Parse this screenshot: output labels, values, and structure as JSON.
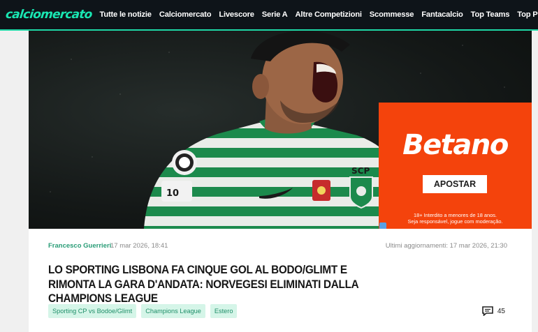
{
  "header": {
    "logo_text": "calciomercato",
    "brand_color": "#19e6b2",
    "nav": [
      "Tutte le notizie",
      "Calciomercato",
      "Livescore",
      "Serie A",
      "Altre Competizioni",
      "Scommesse",
      "Fantacalcio",
      "Top Teams",
      "Top Players"
    ]
  },
  "ad": {
    "brand": "Betano",
    "button_label": "APOSTAR",
    "disclaimer_line1": "18+ Interdito a menores de 18 anos.",
    "disclaimer_line2": "Seja responsável, jogue com moderação.",
    "background_color": "#f4430c"
  },
  "hero": {
    "jersey_text": "SCP",
    "jersey_number": "10"
  },
  "article": {
    "author": "Francesco Guerrieri",
    "date": "17 mar 2026, 18:41",
    "updated": "Ultimi aggiornamenti: 17 mar 2026, 21:30",
    "title": "Lo Sporting Lisbona fa cinque gol al Bodo/Glimt e rimonta la gara d'andata: norvegesi eliminati dalla Champions League",
    "tags": [
      "Sporting CP vs Bodoe/Glimt",
      "Champions League",
      "Estero"
    ],
    "comment_count": "45"
  }
}
